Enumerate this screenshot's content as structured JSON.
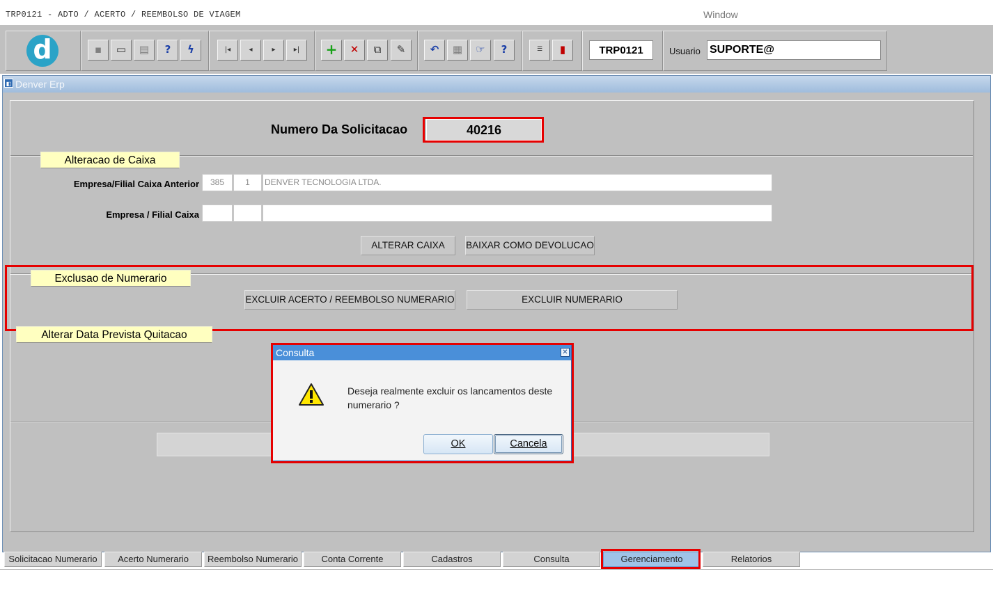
{
  "window": {
    "app_title": "TRP0121 - ADTO / ACERTO / REEMBOLSO DE VIAGEM",
    "window_menu": "Window"
  },
  "toolbar": {
    "form_code": "TRP0121",
    "user_label": "Usuario",
    "user_value": "SUPORTE@"
  },
  "inner_window": {
    "title": "Denver Erp"
  },
  "form": {
    "solicitacao_label": "Numero Da Solicitacao",
    "solicitacao_value": "40216",
    "section_alteracao": "Alteracao de Caixa",
    "caixa_anterior_label": "Empresa/Filial Caixa Anterior",
    "caixa_anterior_empresa": "385",
    "caixa_anterior_filial": "1",
    "caixa_anterior_nome": "DENVER TECNOLOGIA LTDA.",
    "caixa_label": "Empresa / Filial Caixa",
    "caixa_empresa": "",
    "caixa_filial": "",
    "caixa_nome": "",
    "btn_alterar_caixa": "ALTERAR CAIXA",
    "btn_baixar_devolucao": "BAIXAR COMO DEVOLUCAO",
    "section_exclusao": "Exclusao de Numerario",
    "btn_excluir_acerto": "EXCLUIR ACERTO / REEMBOLSO NUMERARIO",
    "btn_excluir_numerario": "EXCLUIR NUMERARIO",
    "section_alterar_data": "Alterar Data Prevista Quitacao"
  },
  "dialog": {
    "title": "Consulta",
    "message": "Deseja realmente excluir os lancamentos deste numerario ?",
    "ok_label": "OK",
    "cancel_label": "Cancela"
  },
  "tabs": [
    {
      "label": "Solicitacao Numerario",
      "active": false
    },
    {
      "label": "Acerto Numerario",
      "active": false
    },
    {
      "label": "Reembolso Numerario",
      "active": false
    },
    {
      "label": "Conta Corrente",
      "active": false
    },
    {
      "label": "Cadastros",
      "active": false
    },
    {
      "label": "Consulta",
      "active": false
    },
    {
      "label": "Gerenciamento",
      "active": true
    },
    {
      "label": "Relatorios",
      "active": false
    }
  ],
  "colors": {
    "highlight": "#e60000",
    "section_label_bg": "#ffffc0",
    "active_tab": "#9fc3e7",
    "dialog_title": "#4a8fd9"
  }
}
